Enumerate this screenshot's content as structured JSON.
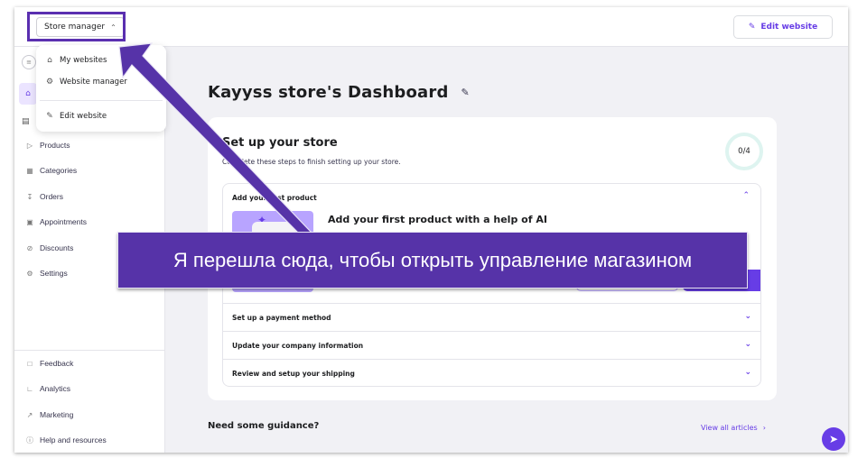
{
  "header": {
    "store_manager_label": "Store manager",
    "store_manager_chevron": "^",
    "edit_website_label": "Edit website"
  },
  "dropdown": {
    "items": [
      {
        "label": "My websites",
        "icon": "home-icon"
      },
      {
        "label": "Website manager",
        "icon": "gear-icon"
      },
      {
        "label": "Edit website",
        "icon": "pencil-icon"
      }
    ]
  },
  "sidebar": {
    "items": [
      {
        "label": "Products",
        "icon": "tag-icon"
      },
      {
        "label": "Categories",
        "icon": "grid-icon"
      },
      {
        "label": "Orders",
        "icon": "download-icon"
      },
      {
        "label": "Appointments",
        "icon": "calendar-icon"
      },
      {
        "label": "Discounts",
        "icon": "discount-icon"
      },
      {
        "label": "Settings",
        "icon": "gear-icon"
      }
    ],
    "bottom_items": [
      {
        "label": "Feedback",
        "icon": "chat-icon"
      },
      {
        "label": "Analytics",
        "icon": "chart-icon"
      },
      {
        "label": "Marketing",
        "icon": "trend-icon"
      },
      {
        "label": "Help and resources",
        "icon": "help-icon"
      }
    ]
  },
  "main": {
    "title": "Kayyss store's Dashboard",
    "setup": {
      "title": "Set up your store",
      "subtitle": "Complete these steps to finish setting up your store.",
      "progress_text": "0/4",
      "progress_done": 0,
      "progress_total": 4,
      "open_step": {
        "title": "Add your first product",
        "headline": "Add your first product with a help of AI"
      },
      "steps": [
        "Set up a payment method",
        "Update your company information",
        "Review and setup your shipping"
      ]
    },
    "guidance": {
      "title": "Need some guidance?",
      "view_all_label": "View all articles"
    }
  },
  "annotation": {
    "text": "Я перешла сюда, чтобы открыть управление магазином"
  },
  "colors": {
    "accent": "#673de6",
    "annotation_bg": "#5633a8"
  }
}
